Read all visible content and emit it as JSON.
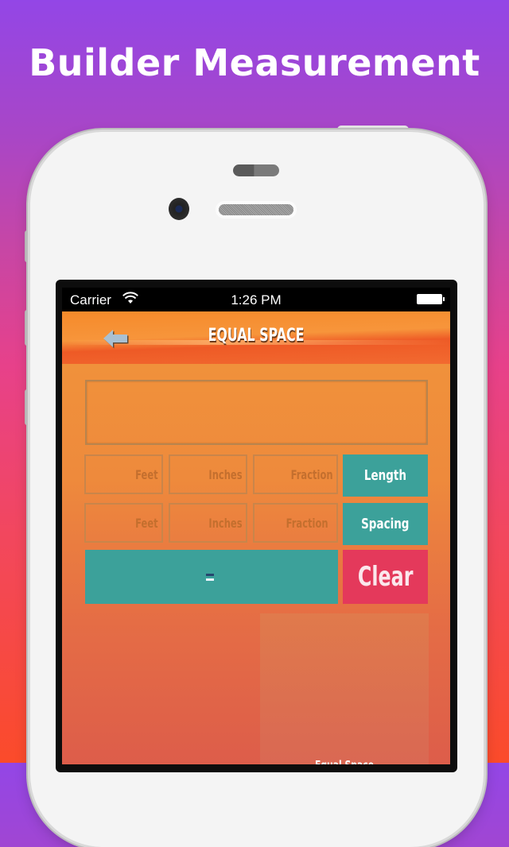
{
  "headline": "Builder Measurement",
  "statusbar": {
    "carrier": "Carrier",
    "time": "1:26 PM"
  },
  "navbar": {
    "title": "EQUAL SPACE",
    "back_icon": "back-arrow-icon"
  },
  "display": {
    "value": ""
  },
  "length_row": {
    "feet_placeholder": "Feet",
    "inches_placeholder": "Inches",
    "fraction_placeholder": "Fraction",
    "button_label": "Length"
  },
  "spacing_row": {
    "feet_placeholder": "Feet",
    "inches_placeholder": "Inches",
    "fraction_placeholder": "Fraction",
    "button_label": "Spacing"
  },
  "actions": {
    "equals_icon": "equals-icon",
    "clear_label": "Clear"
  },
  "result_panel": {
    "label": "Equal Space"
  },
  "colors": {
    "teal": "#3ca19a",
    "clear_red": "#e4395b",
    "orange": "#f2963a"
  }
}
